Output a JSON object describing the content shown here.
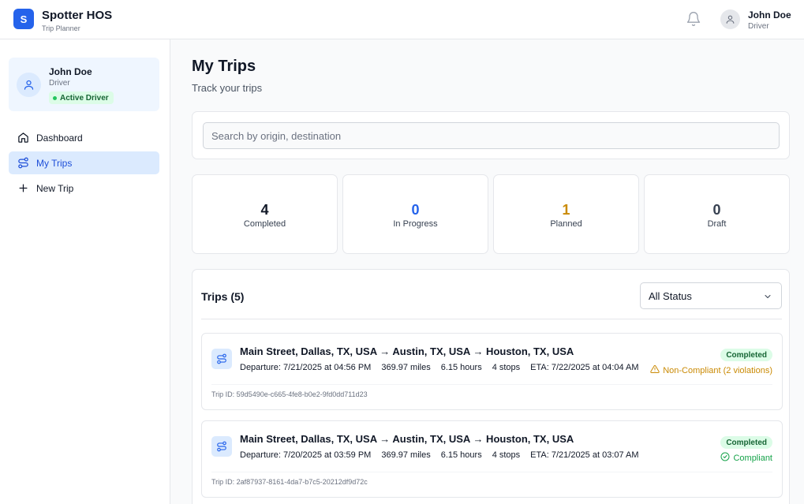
{
  "header": {
    "logo_letter": "S",
    "app_name": "Spotter HOS",
    "app_subtitle": "Trip Planner",
    "user_name": "John Doe",
    "user_role": "Driver"
  },
  "sidebar": {
    "user_card": {
      "name": "John Doe",
      "role": "Driver",
      "badge": "Active Driver"
    },
    "items": [
      {
        "label": "Dashboard",
        "icon": "home-icon"
      },
      {
        "label": "My Trips",
        "icon": "route-icon",
        "active": true
      },
      {
        "label": "New Trip",
        "icon": "plus-icon"
      }
    ]
  },
  "main": {
    "title": "My Trips",
    "subtitle": "Track your trips",
    "search": {
      "placeholder": "Search by origin, destination",
      "value": ""
    },
    "stats": [
      {
        "value": "4",
        "label": "Completed",
        "color": "#111827"
      },
      {
        "value": "0",
        "label": "In Progress",
        "color": "#2563eb"
      },
      {
        "value": "1",
        "label": "Planned",
        "color": "#ca8a04"
      },
      {
        "value": "0",
        "label": "Draft",
        "color": "#374151"
      }
    ],
    "trips_title": "Trips (5)",
    "status_filter": "All Status",
    "trips": [
      {
        "route": "Main Street, Dallas, TX, USA → Austin, TX, USA → Houston, TX, USA",
        "departure": "Departure: 7/21/2025 at 04:56 PM",
        "miles": "369.97 miles",
        "hours": "6.15 hours",
        "stops": "4 stops",
        "eta": "ETA: 7/22/2025 at 04:04 AM",
        "status": "Completed",
        "compliance": "Non-Compliant (2 violations)",
        "compliance_type": "warn",
        "trip_id": "Trip ID: 59d5490e-c665-4fe8-b0e2-9fd0dd711d23"
      },
      {
        "route": "Main Street, Dallas, TX, USA → Austin, TX, USA → Houston, TX, USA",
        "departure": "Departure: 7/20/2025 at 03:59 PM",
        "miles": "369.97 miles",
        "hours": "6.15 hours",
        "stops": "4 stops",
        "eta": "ETA: 7/21/2025 at 03:07 AM",
        "status": "Completed",
        "compliance": "Compliant",
        "compliance_type": "ok",
        "trip_id": "Trip ID: 2af87937-8161-4da7-b7c5-20212df9d72c"
      }
    ]
  }
}
